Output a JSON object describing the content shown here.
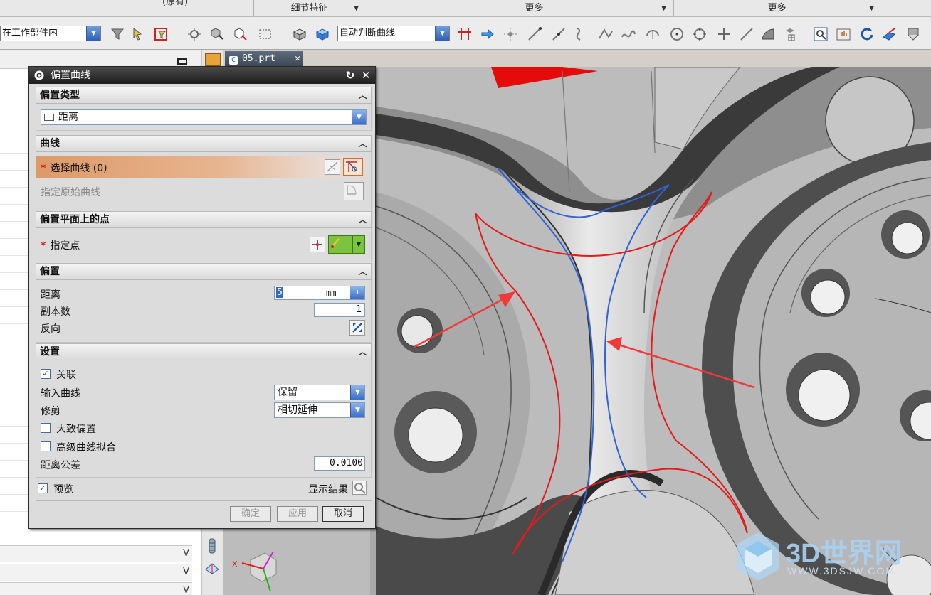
{
  "menu": {
    "clipped_label": "(原有)",
    "groups": [
      {
        "label": "细节特征"
      },
      {
        "label": "更多"
      },
      {
        "label": "更多"
      }
    ]
  },
  "toolbar": {
    "scope_select": "在工作部件内",
    "curve_rule_select": "自动判断曲线"
  },
  "tab": {
    "label": "05.prt"
  },
  "dialog": {
    "title": "偏置曲线",
    "sections": {
      "offset_type": {
        "title": "偏置类型",
        "type_value": "距离"
      },
      "curve": {
        "title": "曲线",
        "select_curve": "选择曲线 (0)",
        "specify_original": "指定原始曲线"
      },
      "plane_point": {
        "title": "偏置平面上的点",
        "specify_point": "指定点"
      },
      "offset": {
        "title": "偏置",
        "distance_label": "距离",
        "distance_value": "5",
        "distance_unit": "mm",
        "copies_label": "副本数",
        "copies_value": "1",
        "reverse_label": "反向"
      },
      "settings": {
        "title": "设置",
        "associative_label": "关联",
        "associative_checked": true,
        "input_curve_label": "输入曲线",
        "input_curve_value": "保留",
        "trim_label": "修剪",
        "trim_value": "相切延伸",
        "rough_offset_label": "大致偏置",
        "rough_offset_checked": false,
        "advanced_fit_label": "高级曲线拟合",
        "advanced_fit_checked": false,
        "tolerance_label": "距离公差",
        "tolerance_value": "0.0100"
      }
    },
    "preview_label": "预览",
    "preview_checked": true,
    "show_result_label": "显示结果",
    "buttons": {
      "ok": "确定",
      "apply": "应用",
      "cancel": "取消"
    }
  },
  "viewport": {
    "triad_x_label": "X"
  },
  "watermark": {
    "brand": "3D世界网",
    "url": "WWW.3DSJW.COM"
  },
  "colors": {
    "title_bar": "#1e1e1e",
    "selection_highlight": "#dc9a68",
    "offset_curve": "#e41b1b",
    "source_curve": "#2f63d6",
    "annotation_arrow": "#f03a3a",
    "combo_button": "#3c6cc4"
  }
}
